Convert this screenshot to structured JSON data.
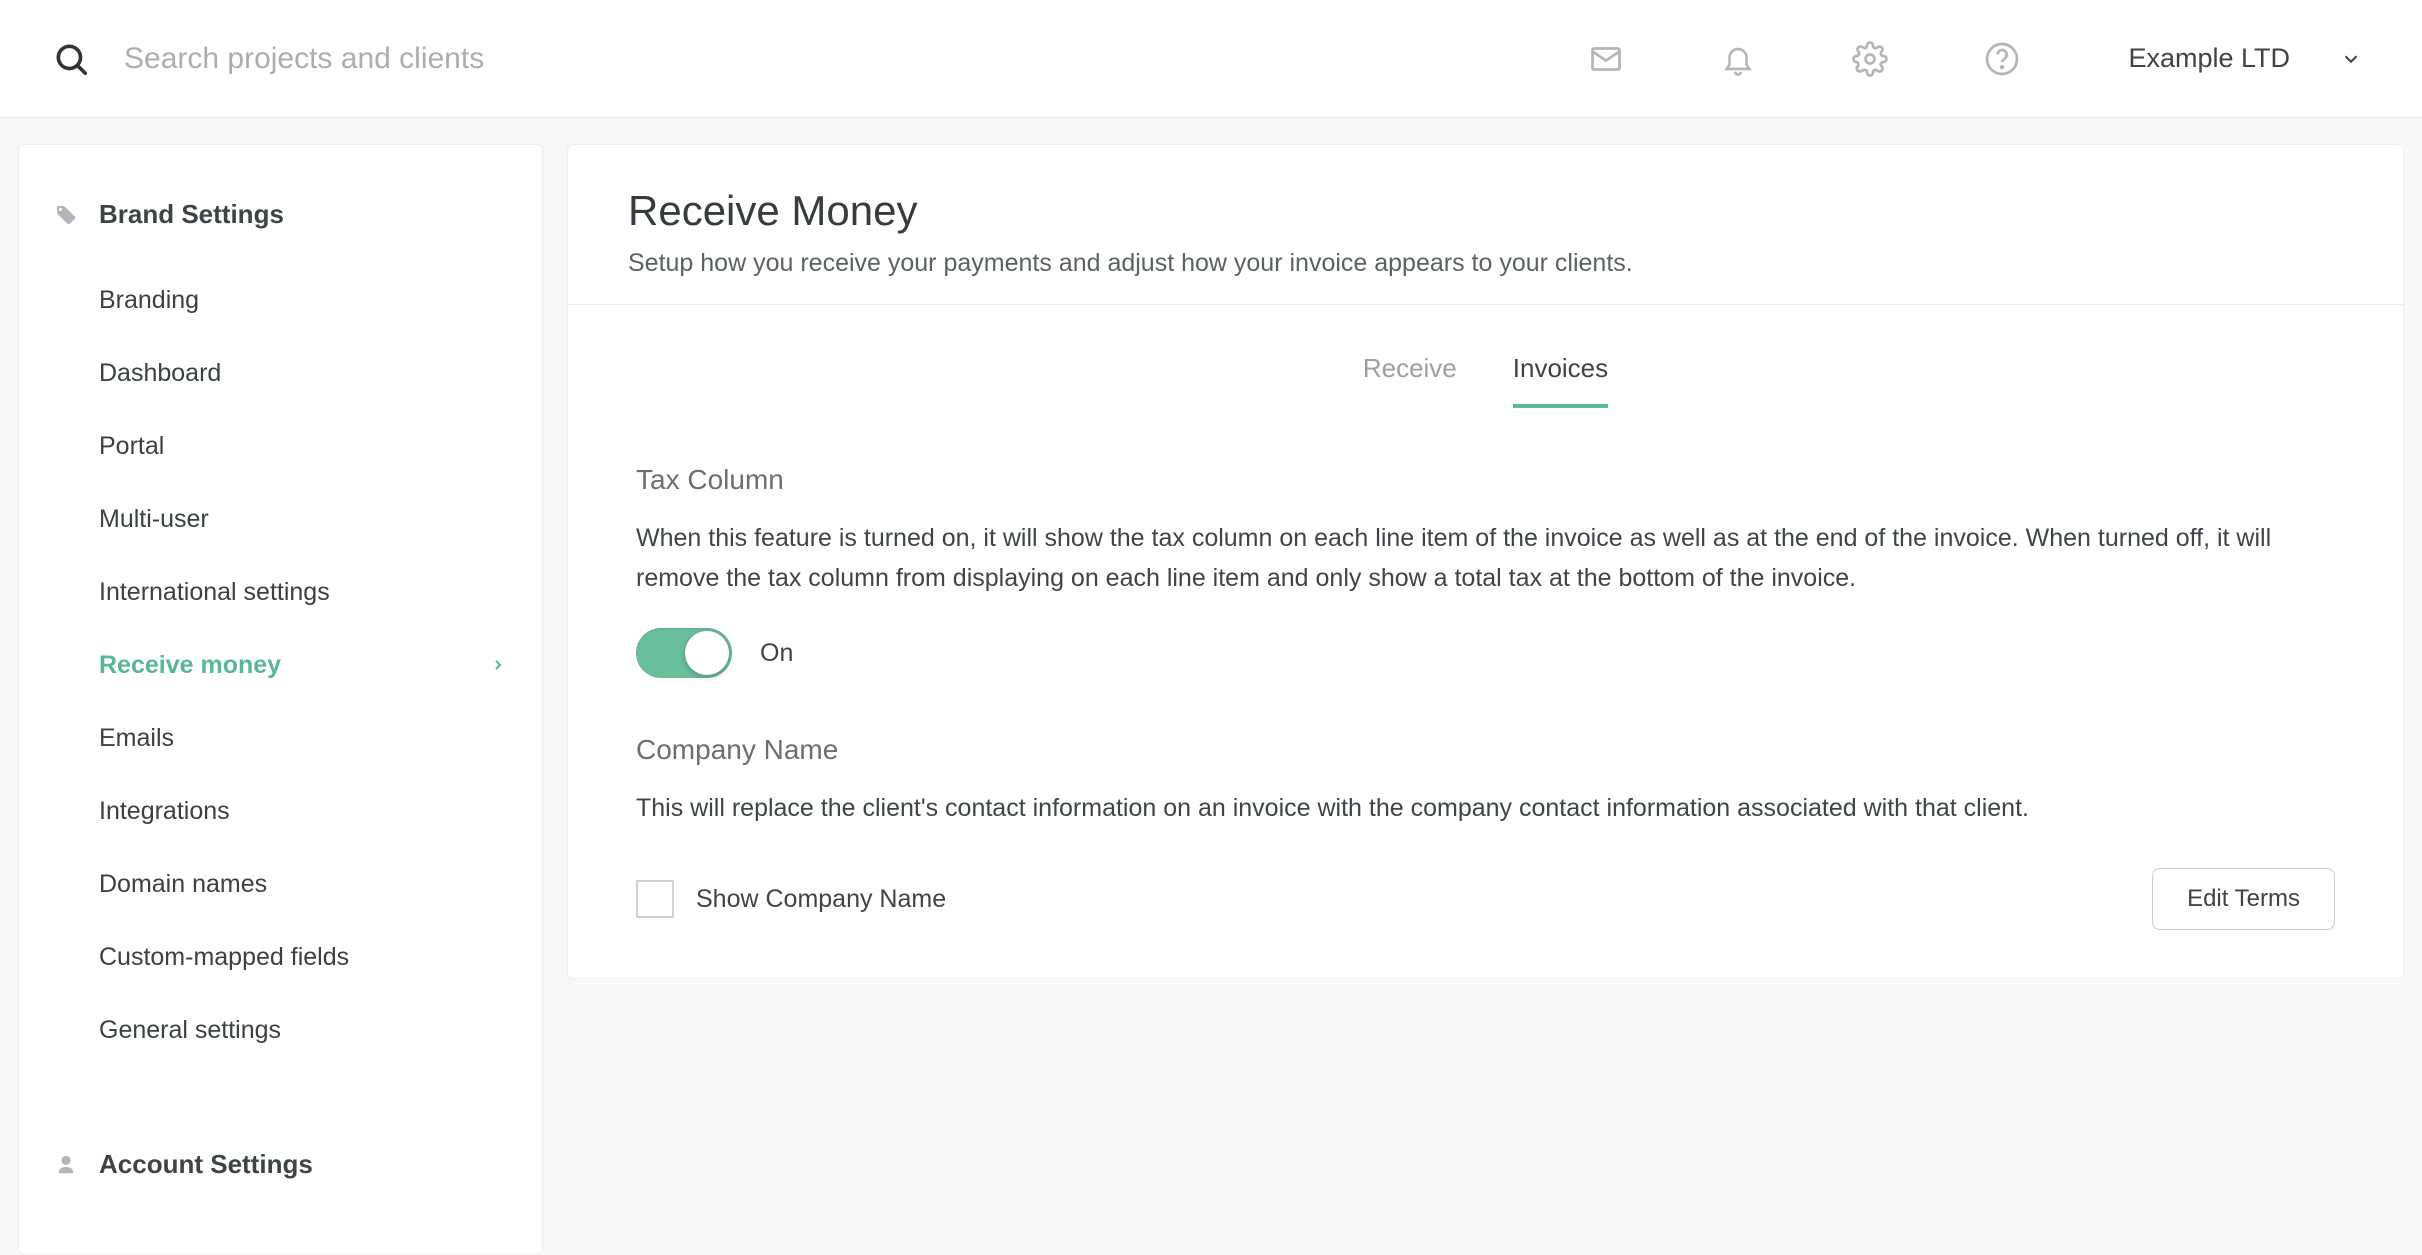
{
  "header": {
    "search_placeholder": "Search projects and clients",
    "company_name": "Example LTD"
  },
  "sidebar": {
    "brand_settings_label": "Brand Settings",
    "items": [
      {
        "label": "Branding",
        "active": false
      },
      {
        "label": "Dashboard",
        "active": false
      },
      {
        "label": "Portal",
        "active": false
      },
      {
        "label": "Multi-user",
        "active": false
      },
      {
        "label": "International settings",
        "active": false
      },
      {
        "label": "Receive money",
        "active": true
      },
      {
        "label": "Emails",
        "active": false
      },
      {
        "label": "Integrations",
        "active": false
      },
      {
        "label": "Domain names",
        "active": false
      },
      {
        "label": "Custom-mapped fields",
        "active": false
      },
      {
        "label": "General settings",
        "active": false
      }
    ],
    "account_settings_label": "Account Settings"
  },
  "main": {
    "title": "Receive Money",
    "subtitle": "Setup how you receive your payments and adjust how your invoice appears to your clients.",
    "tabs": [
      {
        "label": "Receive",
        "active": false
      },
      {
        "label": "Invoices",
        "active": true
      }
    ],
    "tax_column": {
      "title": "Tax Column",
      "desc": "When this feature is turned on, it will show the tax column on each line item of the invoice as well as at the end of the invoice. When turned off, it will remove the tax column from displaying on each line item and only show a total tax at the bottom of the invoice.",
      "toggle_state": "On"
    },
    "company_name": {
      "title": "Company Name",
      "desc": "This will replace the client's contact information on an invoice with the company contact information associated with that client.",
      "checkbox_label": "Show Company Name",
      "checked": false
    },
    "edit_terms_label": "Edit Terms"
  },
  "colors": {
    "accent": "#58b896"
  }
}
